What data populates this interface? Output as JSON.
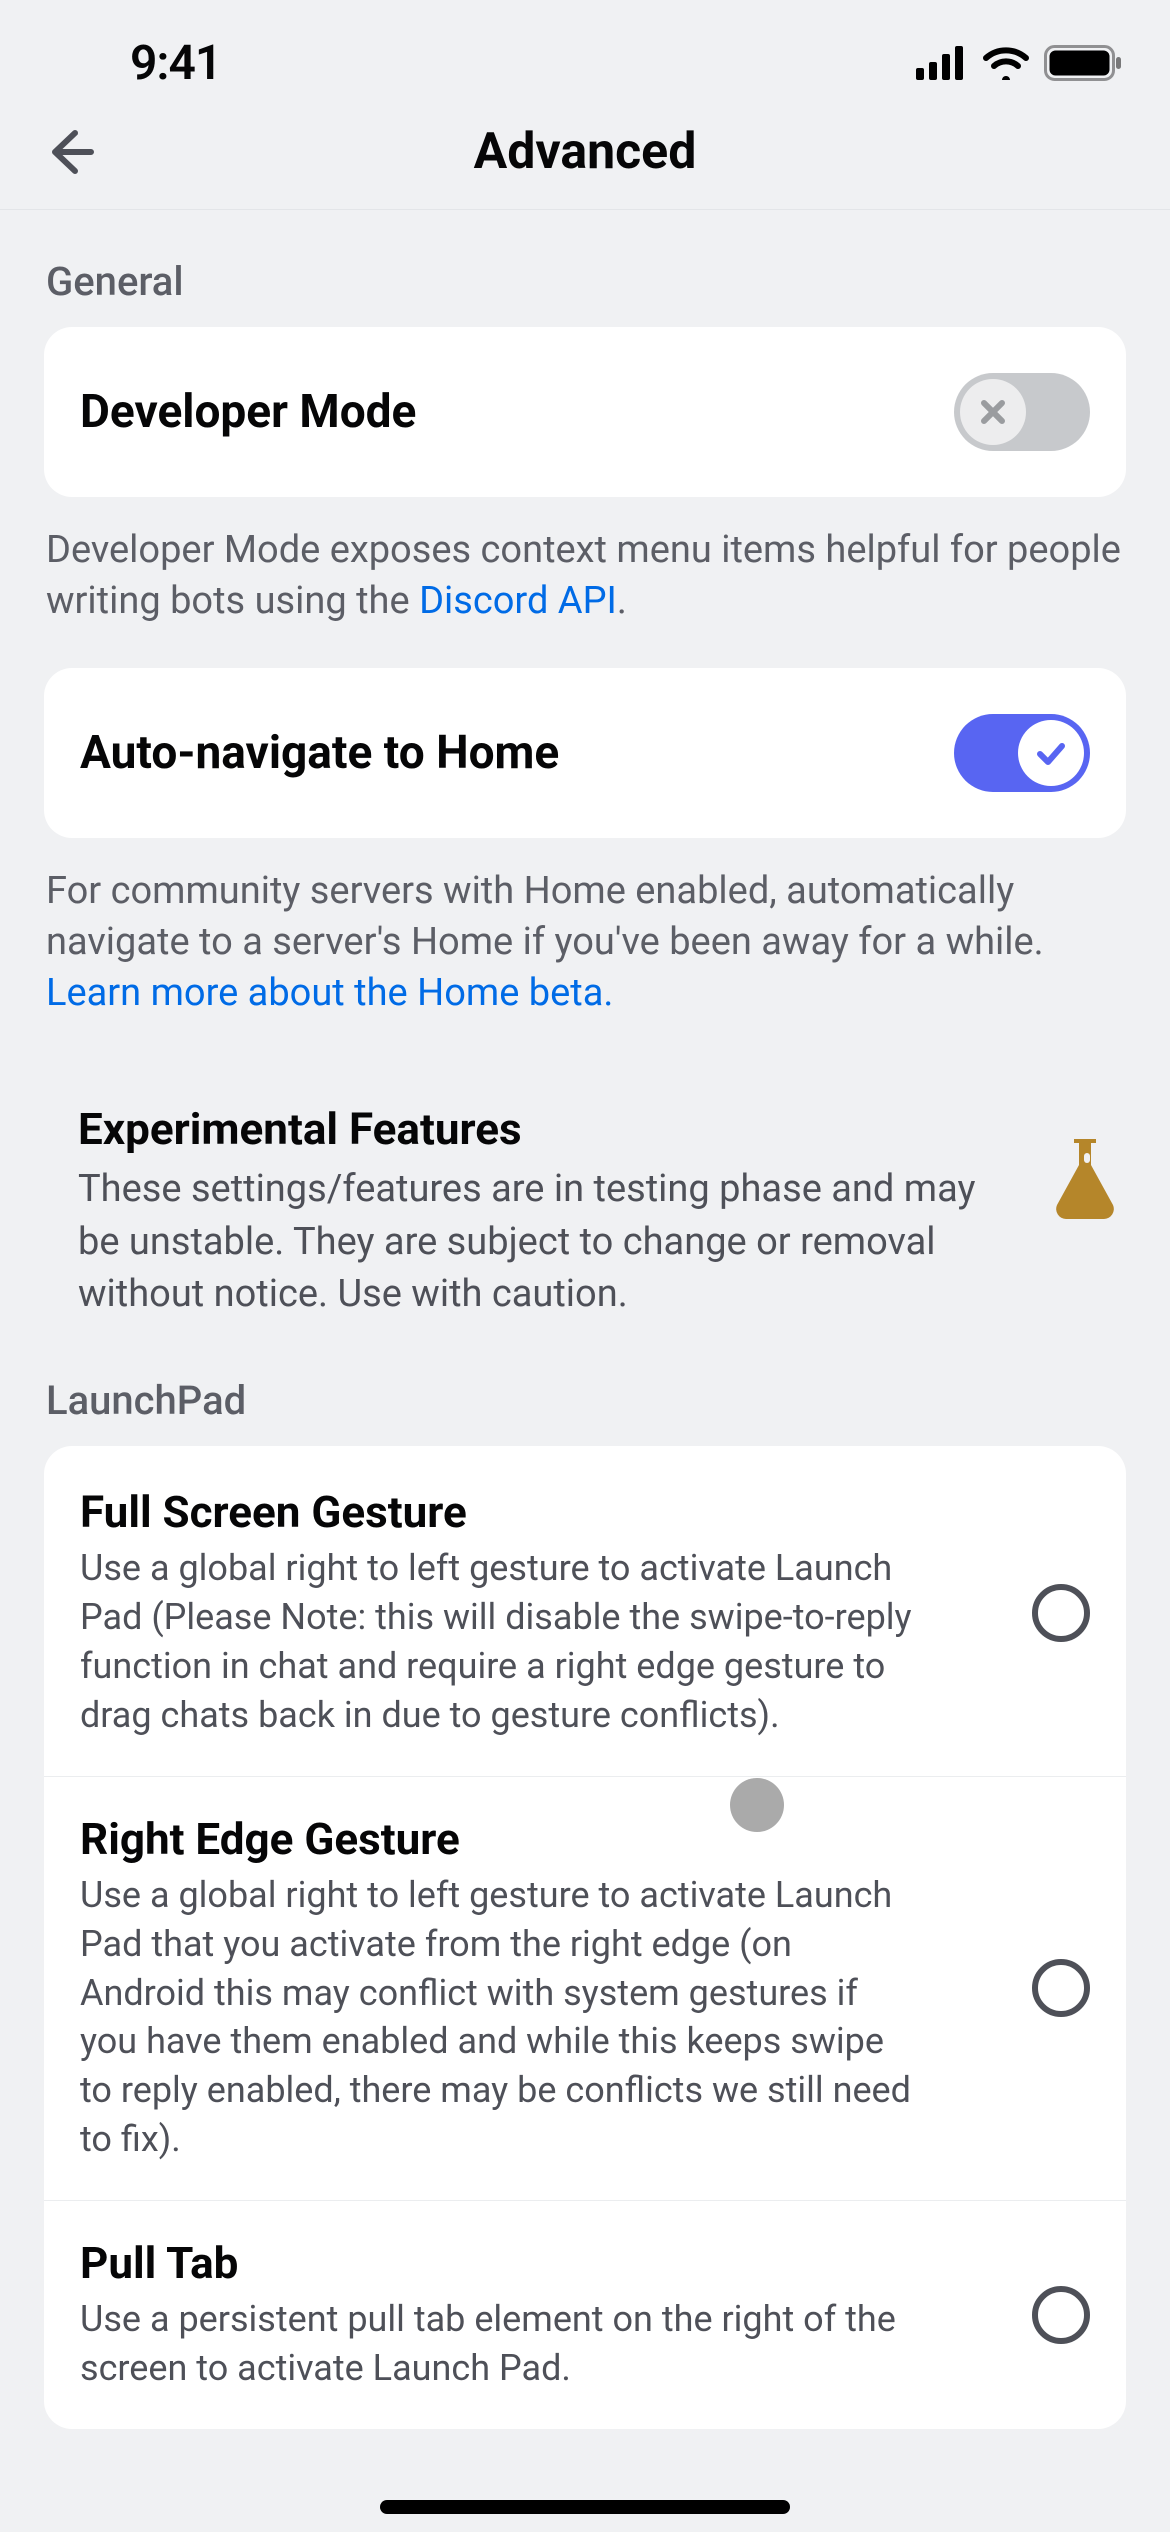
{
  "status": {
    "time": "9:41"
  },
  "header": {
    "title": "Advanced"
  },
  "sections": {
    "general": {
      "label": "General",
      "developer_mode": {
        "title": "Developer Mode",
        "enabled": false,
        "helper_pre": "Developer Mode exposes context menu items helpful for people writing bots using the ",
        "helper_link": "Discord API",
        "helper_post": "."
      },
      "auto_home": {
        "title": "Auto-navigate to Home",
        "enabled": true,
        "helper_pre": "For community servers with Home enabled, automatically navigate to a server's Home if you've been away for a while. ",
        "helper_link": "Learn more about the Home beta.",
        "helper_post": ""
      }
    },
    "experimental": {
      "title": "Experimental Features",
      "desc": "These settings/features are in testing phase and may be unstable. They are subject to change or removal without notice. Use with caution."
    },
    "launchpad": {
      "label": "LaunchPad",
      "items": [
        {
          "title": "Full Screen Gesture",
          "desc": "Use a global right to left gesture to activate Launch Pad (Please Note: this will disable the swipe-to-reply function in chat and require a right edge gesture to drag chats back in due to gesture conflicts).",
          "selected": false
        },
        {
          "title": "Right Edge Gesture",
          "desc": "Use a global right to left gesture to activate Launch Pad that you activate from the right edge (on Android this may conflict with system gestures if you have them enabled and while this keeps swipe to reply enabled, there may be conflicts we still need to fix).",
          "selected": false
        },
        {
          "title": "Pull Tab",
          "desc": "Use a persistent pull tab element on the right of the screen to activate Launch Pad.",
          "selected": false
        }
      ]
    }
  }
}
